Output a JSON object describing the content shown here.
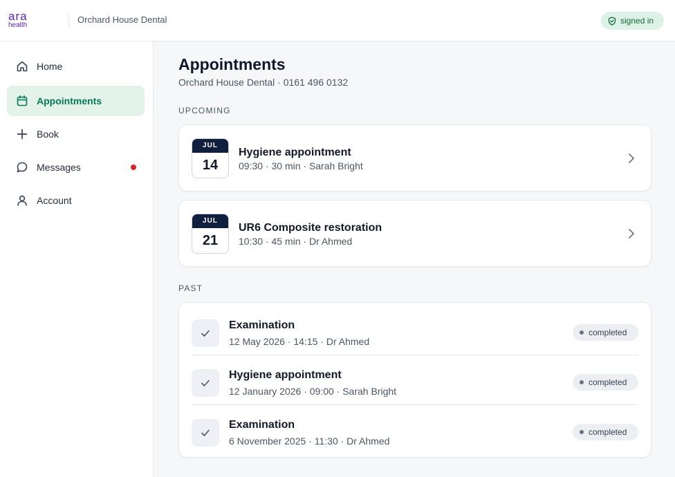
{
  "header": {
    "logo_top": "ara",
    "logo_bottom": "health",
    "practice": "Orchard House Dental",
    "status": "signed in"
  },
  "sidebar": {
    "items": [
      {
        "label": "Home",
        "icon": "home-icon"
      },
      {
        "label": "Appointments",
        "icon": "calendar-icon",
        "active": true
      },
      {
        "label": "Book",
        "icon": "plus-icon"
      },
      {
        "label": "Messages",
        "icon": "chat-bubble-icon",
        "notification": true
      },
      {
        "label": "Account",
        "icon": "user-icon"
      }
    ]
  },
  "main": {
    "title": "Appointments",
    "subtitle": "Orchard House Dental · 0161 496 0132",
    "upcoming_label": "UPCOMING",
    "upcoming": [
      {
        "month": "JUL",
        "day": "14",
        "title": "Hygiene appointment",
        "meta": "09:30 · 30 min · Sarah Bright"
      },
      {
        "month": "JUL",
        "day": "21",
        "title": "UR6 Composite restoration",
        "meta": "10:30 · 45 min · Dr Ahmed"
      }
    ],
    "past_label": "PAST",
    "past": [
      {
        "title": "Examination",
        "meta": "12 May 2026 · 14:15 · Dr Ahmed",
        "status": "completed"
      },
      {
        "title": "Hygiene appointment",
        "meta": "12 January 2026 · 09:00 · Sarah Bright",
        "status": "completed"
      },
      {
        "title": "Examination",
        "meta": "6 November 2025 · 11:30 · Dr Ahmed",
        "status": "completed"
      }
    ]
  },
  "colors": {
    "brand": "#5b21b6",
    "accent": "#047857",
    "active_bg": "#e3f3ea",
    "date_header": "#0f1f3d",
    "notification": "#dc2626"
  }
}
